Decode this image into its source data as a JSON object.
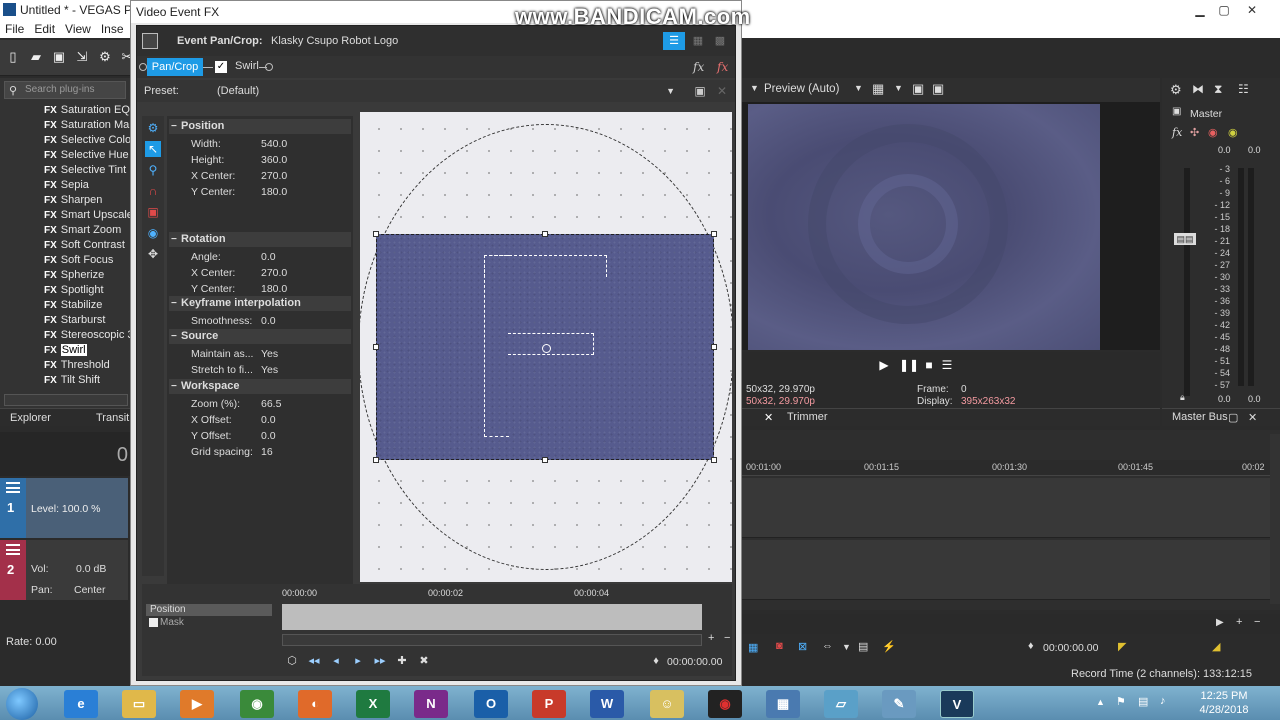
{
  "app": {
    "title": "Untitled * - VEGAS Pr",
    "menu": [
      "File",
      "Edit",
      "View",
      "Inse"
    ]
  },
  "plugins": {
    "search_placeholder": "Search plug-ins",
    "items": [
      "Saturation EQ",
      "Saturation Ma",
      "Selective Colo",
      "Selective Hue",
      "Selective Tint",
      "Sepia",
      "Sharpen",
      "Smart Upscale",
      "Smart Zoom",
      "Soft Contrast",
      "Soft Focus",
      "Spherize",
      "Spotlight",
      "Stabilize",
      "Starburst",
      "Stereoscopic 3",
      "Swirl",
      "Threshold",
      "Tilt Shift"
    ],
    "selected": "Swirl",
    "fx_badge": "FX"
  },
  "tabs_left": {
    "explorer": "Explorer",
    "transitions": "Transit"
  },
  "timeline_left": {
    "timecode": "0",
    "track1": {
      "number": "1",
      "level": "Level: 100.0 %"
    },
    "track2": {
      "number": "2",
      "vol_label": "Vol:",
      "vol_value": "0.0 dB",
      "pan_label": "Pan:",
      "pan_value": "Center"
    },
    "rate": "Rate: 0.00"
  },
  "dialog": {
    "title": "Video Event FX",
    "header_label": "Event Pan/Crop:",
    "header_value": "Klasky Csupo Robot Logo",
    "chain": {
      "pan_crop": "Pan/Crop",
      "swirl": "Swirl",
      "swirl_checked": "✓"
    },
    "preset_label": "Preset:",
    "preset_value": "(Default)",
    "sections": [
      {
        "name": "Position",
        "rows": [
          [
            "Width:",
            "540.0"
          ],
          [
            "Height:",
            "360.0"
          ],
          [
            "X Center:",
            "270.0"
          ],
          [
            "Y Center:",
            "180.0"
          ]
        ]
      },
      {
        "name": "Rotation",
        "rows": [
          [
            "Angle:",
            "0.0"
          ],
          [
            "X Center:",
            "270.0"
          ],
          [
            "Y Center:",
            "180.0"
          ]
        ]
      },
      {
        "name": "Keyframe interpolation",
        "rows": [
          [
            "Smoothness:",
            "0.0"
          ]
        ]
      },
      {
        "name": "Source",
        "rows": [
          [
            "Maintain as...",
            "Yes"
          ],
          [
            "Stretch to fi...",
            "Yes"
          ]
        ]
      },
      {
        "name": "Workspace",
        "rows": [
          [
            "Zoom (%):",
            "66.5"
          ],
          [
            "X Offset:",
            "0.0"
          ],
          [
            "Y Offset:",
            "0.0"
          ],
          [
            "Grid spacing:",
            "16"
          ]
        ]
      }
    ],
    "keyframes": {
      "ticks": [
        "00:00:00",
        "00:00:02",
        "00:00:04"
      ],
      "position_track": "Position",
      "mask_track": "Mask",
      "time": "00:00:00.00"
    }
  },
  "preview": {
    "mode": "Preview (Auto)",
    "project_line1": "50x32, 29.970p",
    "project_line2": "50x32, 29.970p",
    "frame_label": "Frame:",
    "frame_value": "0",
    "display_label": "Display:",
    "display_value": "395x263x32",
    "trimmer_tab": "Trimmer"
  },
  "master": {
    "label": "Master",
    "values_top": [
      "0.0",
      "0.0"
    ],
    "scale": [
      "3",
      "6",
      "9",
      "12",
      "15",
      "18",
      "21",
      "24",
      "27",
      "30",
      "33",
      "36",
      "39",
      "42",
      "45",
      "48",
      "51",
      "54",
      "57"
    ],
    "values_bottom": [
      "0.0",
      "0.0"
    ],
    "tab": "Master Bus"
  },
  "timeline_right": {
    "ticks": [
      "00:01:00",
      "00:01:15",
      "00:01:30",
      "00:01:45",
      "00:02"
    ],
    "time": "00:00:00.00",
    "record_time": "Record Time (2 channels): 133:12:15"
  },
  "watermark": "www.BANDICAM.com",
  "taskbar": {
    "time": "12:25 PM",
    "date": "4/28/2018"
  }
}
